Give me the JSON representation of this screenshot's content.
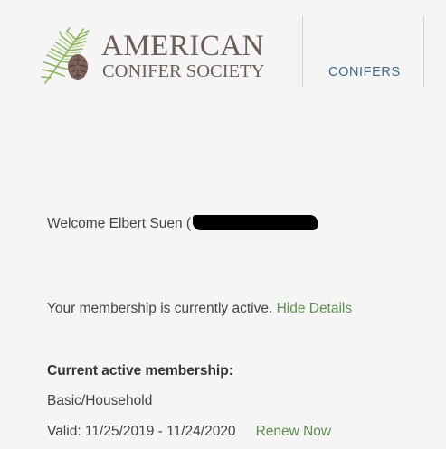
{
  "header": {
    "logo_line1": "AMERICAN",
    "logo_line2": "CONIFER SOCIETY",
    "nav": {
      "conifers_label": "CONIFERS"
    }
  },
  "welcome": {
    "prefix": "Welcome Elbert Suen ("
  },
  "membership": {
    "status_text": "Your membership is currently active.",
    "hide_details_label": "Hide Details",
    "current_title": "Current active membership:",
    "type": "Basic/Household",
    "validity": "Valid: 11/25/2019 - 11/24/2020",
    "renew_label": "Renew Now"
  },
  "colors": {
    "background": "#f5f5f5",
    "logo_text": "#6b5e57",
    "nav_link": "#3b6a8f",
    "action_link": "#5e8f4e",
    "body_text": "#444444"
  }
}
